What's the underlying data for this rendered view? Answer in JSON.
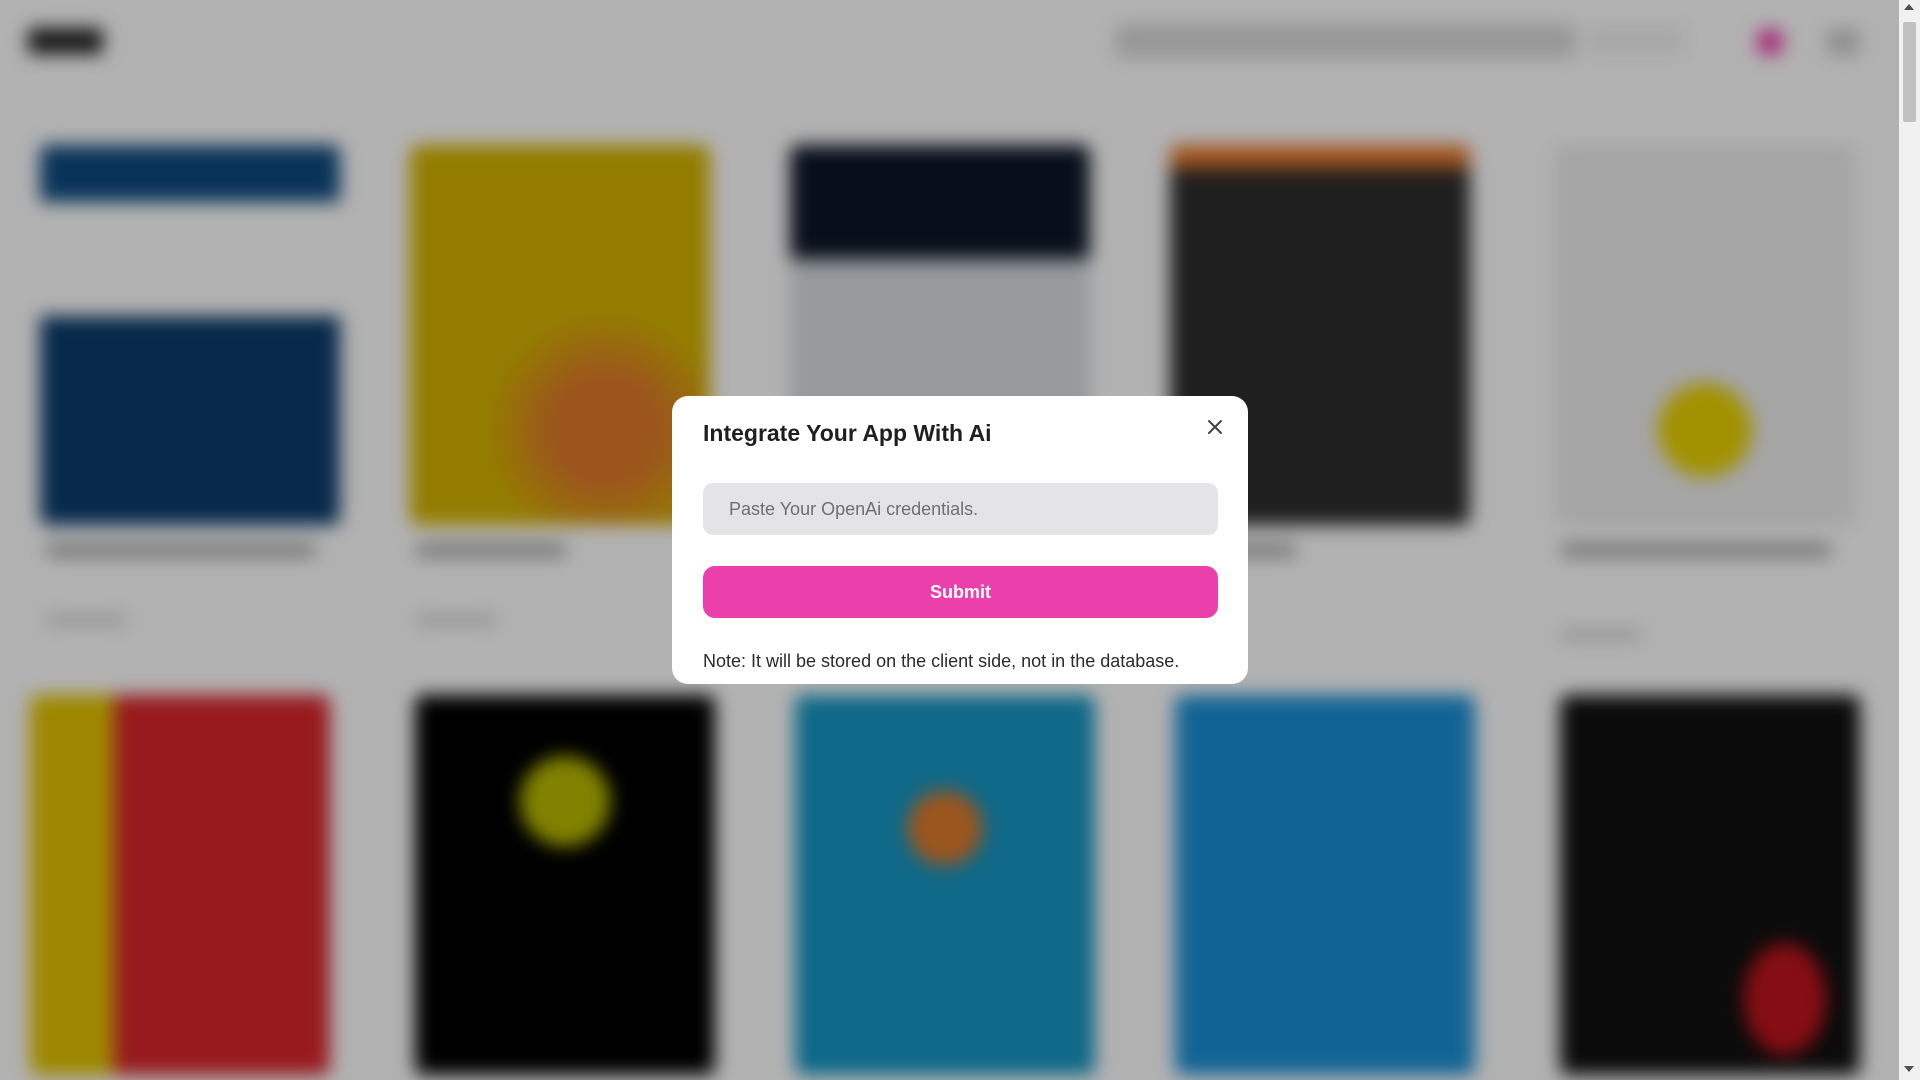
{
  "modal": {
    "title": "Integrate Your App With Ai",
    "input_placeholder": "Paste Your OpenAi credentials.",
    "input_value": "",
    "submit_label": "Submit",
    "note": "Note: It will be stored on the client side, not in the database.",
    "close_icon": "close-icon",
    "submit_color": "#eb3fac"
  },
  "background": {
    "accent_color": "#ee3fae",
    "overlay_color": "rgba(0,0,0,0.30)"
  }
}
